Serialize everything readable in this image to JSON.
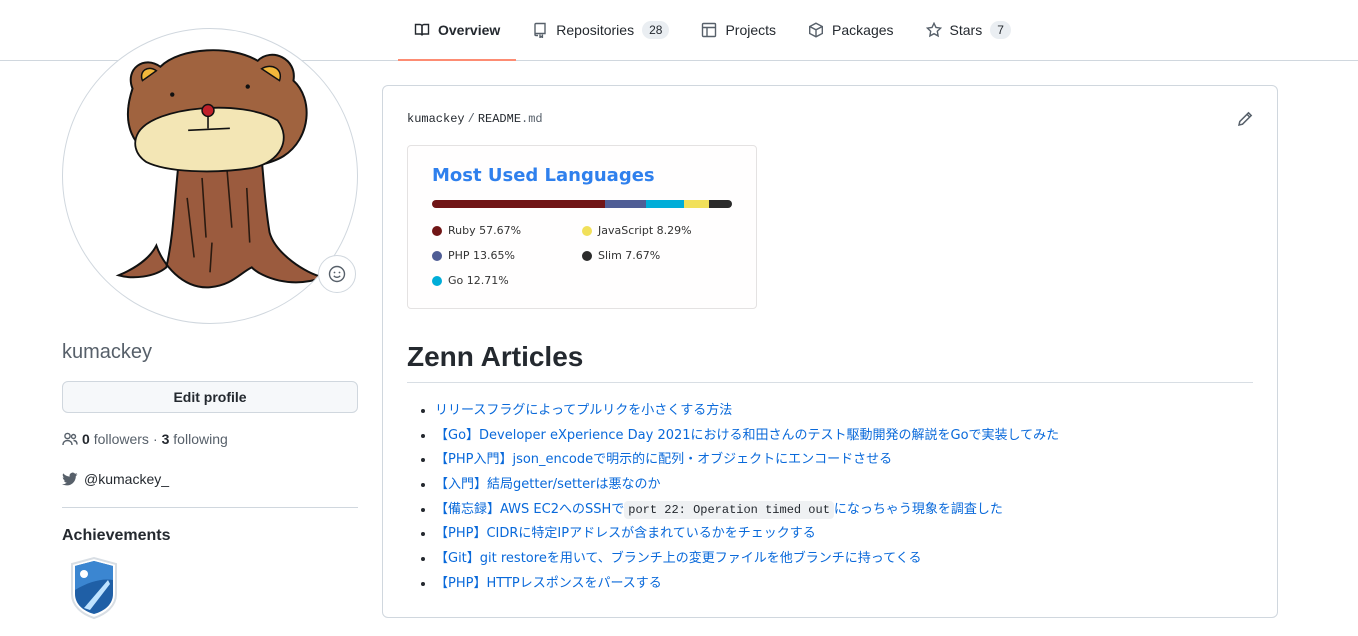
{
  "nav": {
    "tabs": [
      {
        "label": "Overview",
        "icon": "book-icon",
        "active": true
      },
      {
        "label": "Repositories",
        "icon": "repo-icon",
        "count": "28"
      },
      {
        "label": "Projects",
        "icon": "project-icon"
      },
      {
        "label": "Packages",
        "icon": "package-icon"
      },
      {
        "label": "Stars",
        "icon": "star-icon",
        "count": "7"
      }
    ]
  },
  "profile": {
    "username": "kumackey",
    "edit_label": "Edit profile",
    "followers_count": "0",
    "followers_label": "followers",
    "following_count": "3",
    "following_label": "following",
    "dot": "·",
    "twitter": "@kumackey_",
    "achievements_title": "Achievements"
  },
  "readme": {
    "owner": "kumackey",
    "separator": "/",
    "file": "README",
    "ext": ".md",
    "languages": {
      "title": "Most Used Languages",
      "items": [
        {
          "name": "Ruby",
          "percent": 57.67,
          "label": "Ruby 57.67%",
          "color": "#701516"
        },
        {
          "name": "PHP",
          "percent": 13.65,
          "label": "PHP 13.65%",
          "color": "#4F5D95"
        },
        {
          "name": "Go",
          "percent": 12.71,
          "label": "Go 12.71%",
          "color": "#00ADD8"
        },
        {
          "name": "JavaScript",
          "percent": 8.29,
          "label": "JavaScript 8.29%",
          "color": "#f1e05a"
        },
        {
          "name": "Slim",
          "percent": 7.67,
          "label": "Slim 7.67%",
          "color": "#2b2b2b"
        }
      ]
    },
    "zenn_title": "Zenn Articles",
    "articles": [
      {
        "text": "リリースフラグによってプルリクを小さくする方法"
      },
      {
        "text": "【Go】Developer eXperience Day 2021における和田さんのテスト駆動開発の解説をGoで実装してみた"
      },
      {
        "text": "【PHP入門】json_encodeで明示的に配列・オブジェクトにエンコードさせる"
      },
      {
        "text": "【入門】結局getter/setterは悪なのか"
      },
      {
        "text": "【備忘録】AWS EC2へのSSHで",
        "code": "port 22: Operation timed out",
        "after": "になっちゃう現象を調査した"
      },
      {
        "text": "【PHP】CIDRに特定IPアドレスが含まれているかをチェックする"
      },
      {
        "text": "【Git】git restoreを用いて、ブランチ上の変更ファイルを他ブランチに持ってくる"
      },
      {
        "text": "【PHP】HTTPレスポンスをパースする"
      }
    ]
  },
  "colors": {
    "accent_underline": "#fd8c73",
    "link": "#0969da",
    "lang_title": "#2f80ed"
  }
}
